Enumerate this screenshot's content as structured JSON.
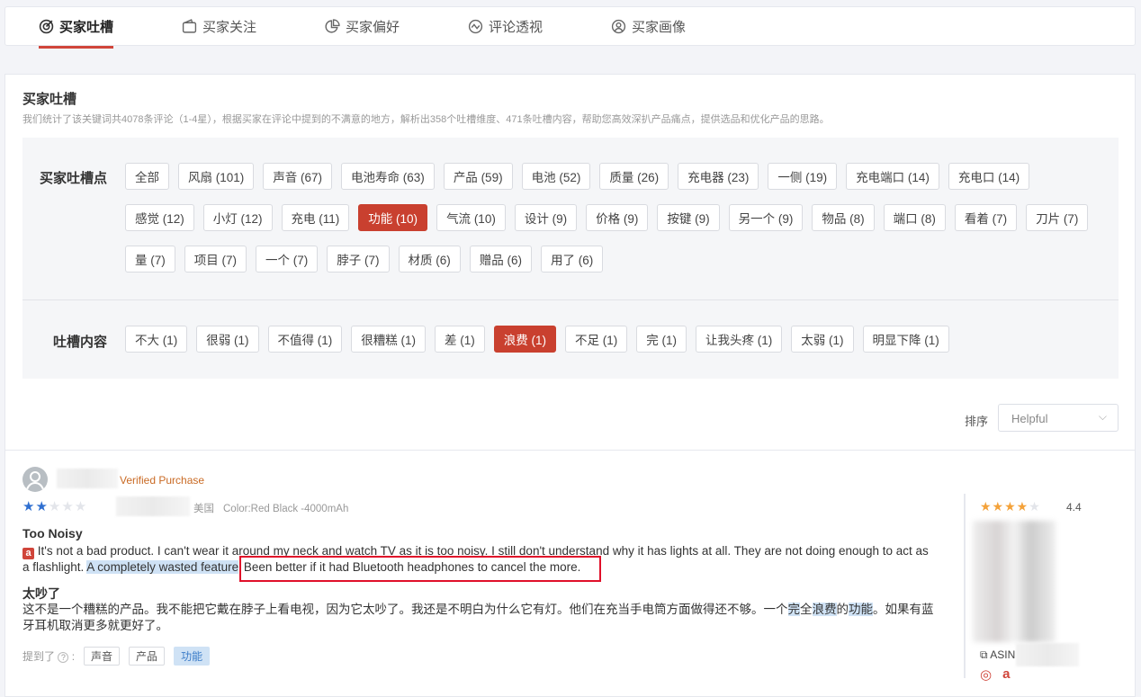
{
  "tabs": [
    {
      "label": "买家吐槽",
      "icon": "target-icon",
      "active": true
    },
    {
      "label": "买家关注",
      "icon": "wallet-icon"
    },
    {
      "label": "买家偏好",
      "icon": "pie-chart-icon"
    },
    {
      "label": "评论透视",
      "icon": "trend-icon"
    },
    {
      "label": "买家画像",
      "icon": "user-circle-icon"
    }
  ],
  "section": {
    "title": "买家吐槽",
    "description": "我们统计了该关键词共4078条评论（1-4星），根据买家在评论中提到的不满意的地方，解析出358个吐槽维度、471条吐槽内容，帮助您高效深扒产品痛点，提供选品和优化产品的思路。"
  },
  "filters": {
    "points_label": "买家吐槽点",
    "points": [
      "全部",
      "风扇 (101)",
      "声音 (67)",
      "电池寿命 (63)",
      "产品 (59)",
      "电池 (52)",
      "质量 (26)",
      "充电器 (23)",
      "一侧 (19)",
      "充电端口 (14)",
      "充电口 (14)",
      "感觉 (12)",
      "小灯 (12)",
      "充电 (11)",
      "功能 (10)",
      "气流 (10)",
      "设计 (9)",
      "价格 (9)",
      "按键 (9)",
      "另一个 (9)",
      "物品 (8)",
      "端口 (8)",
      "看着 (7)",
      "刀片 (7)",
      "量 (7)",
      "项目 (7)",
      "一个 (7)",
      "脖子 (7)",
      "材质 (6)",
      "赠品 (6)",
      "用了 (6)"
    ],
    "points_selected": "功能 (10)",
    "content_label": "吐槽内容",
    "contents": [
      "不大 (1)",
      "很弱 (1)",
      "不值得 (1)",
      "很糟糕 (1)",
      "差 (1)",
      "浪费 (1)",
      "不足 (1)",
      "完 (1)",
      "让我头疼 (1)",
      "太弱 (1)",
      "明显下降 (1)"
    ],
    "content_selected": "浪费 (1)"
  },
  "sort": {
    "label": "排序",
    "value": "Helpful"
  },
  "review": {
    "verified": "Verified Purchase",
    "stars": 2,
    "country": "美国",
    "variant": "Color:Red Black -4000mAh",
    "title": "Too Noisy",
    "body_pre": "It's not a bad product. I can't wear it around my neck and watch TV as it is too noisy. I still don't understand why it has lights at all. They are not doing enough to act as a flashlight. ",
    "body_highlight": "A completely wasted feature",
    "body_boxed": "Been better if it had Bluetooth headphones to cancel the more.",
    "title_zh": "太吵了",
    "body_zh_1": "这不是一个糟糕的产品。我不能把它戴在脖子上看电视，因为它太吵了。我还是不明白为什么它有灯。他们在充当手电筒方面做得还不够。一个",
    "body_zh_h1": "完",
    "body_zh_2": "全",
    "body_zh_h2": "浪费",
    "body_zh_3": "的",
    "body_zh_h3": "功能",
    "body_zh_4": "。如果有蓝牙耳机取消更多就更好了。",
    "mentioned_label": "提到了",
    "mentioned": [
      "声音",
      "产品",
      "功能"
    ],
    "mentioned_active": "功能"
  },
  "product": {
    "rating": "4.4",
    "asin_label": "ASIN"
  },
  "colors": {
    "accent": "#c9402f",
    "highlight": "#cfe2f5",
    "star_blue": "#2f6fd0",
    "star_orange": "#f4a23a"
  }
}
